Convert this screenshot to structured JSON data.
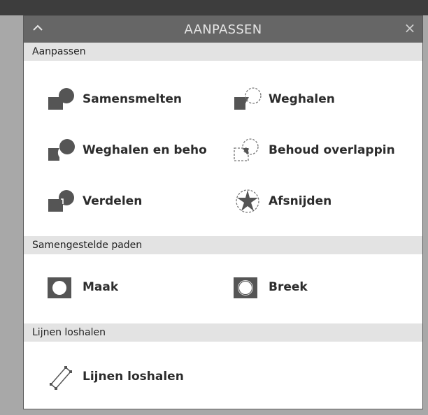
{
  "panel": {
    "title": "AANPASSEN",
    "collapse_icon": "chevron-up-icon",
    "close_icon": "close-icon"
  },
  "sections": {
    "aanpassen": {
      "header": "Aanpassen",
      "items": {
        "samensmelten": "Samensmelten",
        "weghalen": "Weghalen",
        "weghalen_en_behouden": "Weghalen en beho",
        "behoud_overlapping": "Behoud overlappin",
        "verdelen": "Verdelen",
        "afsnijden": "Afsnijden"
      }
    },
    "samengestelde_paden": {
      "header": "Samengestelde paden",
      "items": {
        "maak": "Maak",
        "breek": "Breek"
      }
    },
    "lijnen_loshalen": {
      "header": "Lijnen loshalen",
      "items": {
        "lijnen_loshalen": "Lijnen loshalen"
      }
    }
  },
  "colors": {
    "icon_fill": "#555555",
    "titlebar_bg": "#666666",
    "section_header_bg": "#e3e3e3"
  }
}
